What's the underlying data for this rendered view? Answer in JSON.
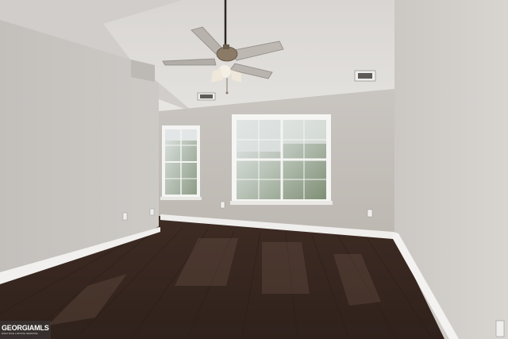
{
  "scene": {
    "description_free": true,
    "colors": {
      "ceiling": "#dcd9d6",
      "wall_left": "#c9c6c2",
      "wall_back": "#c2beb9",
      "wall_right": "#d3d0cc",
      "floor": "#3a2a22",
      "baseboard": "#f2f1ef",
      "window_frame": "#f4f4f2"
    },
    "icons": [
      "ceiling-fan-icon",
      "air-vent-icon",
      "electrical-outlet-icon"
    ]
  },
  "watermark": {
    "brand": "GEORGIAMLS",
    "tagline": "MULTIPLE LISTING SERVICE"
  }
}
